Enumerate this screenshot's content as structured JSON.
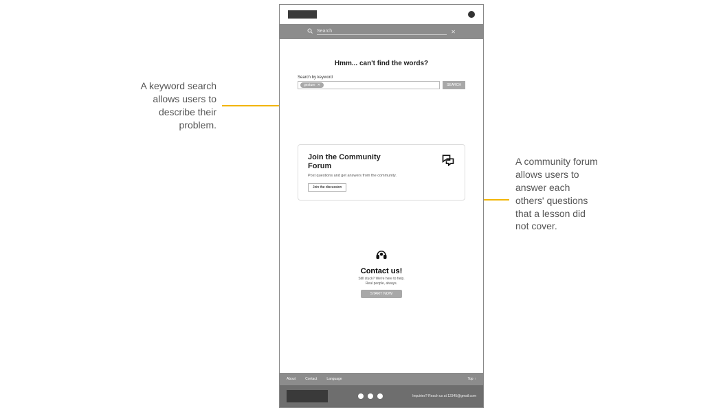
{
  "annotations": {
    "left": "A keyword search allows users to describe their problem.",
    "right": "A community forum allows users to answer each others' questions that a lesson did not cover."
  },
  "topSearch": {
    "placeholder": "Search"
  },
  "page": {
    "heading": "Hmm... can't find the words?"
  },
  "keywordSearch": {
    "label": "Search by keyword",
    "tag": "gesture",
    "button": "SEARCH"
  },
  "communityCard": {
    "title": "Join the Community Forum",
    "subtitle": "Post questions and get answers from the community.",
    "button": "Join the discussion"
  },
  "contact": {
    "title": "Contact us!",
    "line1": "Still stuck? We're here to help.",
    "line2": "Real people, always.",
    "button": "START NOW"
  },
  "footerLinks": {
    "about": "About",
    "contact": "Contact",
    "language": "Language",
    "top": "Top"
  },
  "darkFooter": {
    "text": "Inquiries? Reach us at 12345@gmail.com"
  }
}
